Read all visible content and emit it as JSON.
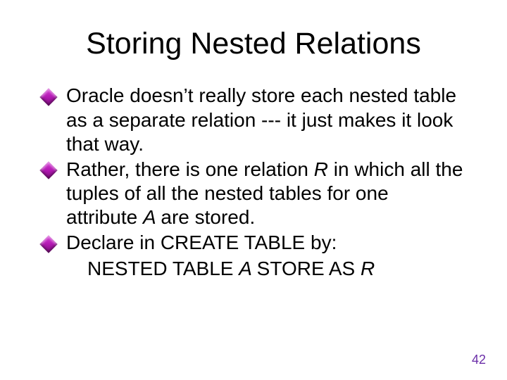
{
  "title": "Storing Nested Relations",
  "bullets": {
    "b1": "Oracle doesn’t really store each nested table as a separate relation --- it just makes it look that way.",
    "b2_pre": "Rather, there is one relation ",
    "b2_r": "R ",
    "b2_mid": " in which all the tuples of all the nested tables for one attribute ",
    "b2_a": "A ",
    "b2_post": " are stored.",
    "b3": "Declare in CREATE TABLE by:",
    "sub_pre": "NESTED TABLE ",
    "sub_a": "A ",
    "sub_mid": " STORE AS ",
    "sub_r": "R"
  },
  "page_number": "42"
}
